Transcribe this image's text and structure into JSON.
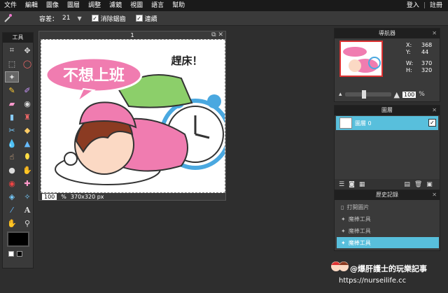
{
  "menubar": {
    "items": [
      "文件",
      "編輯",
      "圖像",
      "圖層",
      "調整",
      "濾鏡",
      "視圖",
      "語言",
      "幫助"
    ],
    "login": "登入",
    "register": "註冊"
  },
  "options": {
    "tolerance_label": "容差：",
    "tolerance_value": "21",
    "antialias_label": "消除鋸齒",
    "contiguous_label": "連續"
  },
  "toolbox": {
    "title": "工具",
    "fg_color": "#000000"
  },
  "document": {
    "title": "1",
    "zoom": "100",
    "zoom_unit": "%",
    "size": "370x320 px",
    "art_title": "不想上班",
    "art_caption": "趕床！"
  },
  "navigator": {
    "title": "導航器",
    "x_label": "X:",
    "x_value": "368",
    "y_label": "Y:",
    "y_value": "44",
    "w_label": "W:",
    "w_value": "370",
    "h_label": "H:",
    "h_value": "320",
    "zoom": "100",
    "zoom_unit": "%"
  },
  "layers": {
    "title": "圖層",
    "items": [
      {
        "name": "圖層 0"
      }
    ]
  },
  "history": {
    "title": "歷史記錄",
    "items": [
      {
        "label": "打開圖片"
      },
      {
        "label": "魔棒工具"
      },
      {
        "label": "魔棒工具"
      },
      {
        "label": "魔棒工具"
      }
    ]
  },
  "watermark": {
    "line1": "@爆肝護士的玩樂記事",
    "line2": "https://nurseilife.cc"
  },
  "colors": {
    "accent": "#58bfdc",
    "menubar": "#1a1a1a",
    "panel": "#3a3a3a"
  }
}
